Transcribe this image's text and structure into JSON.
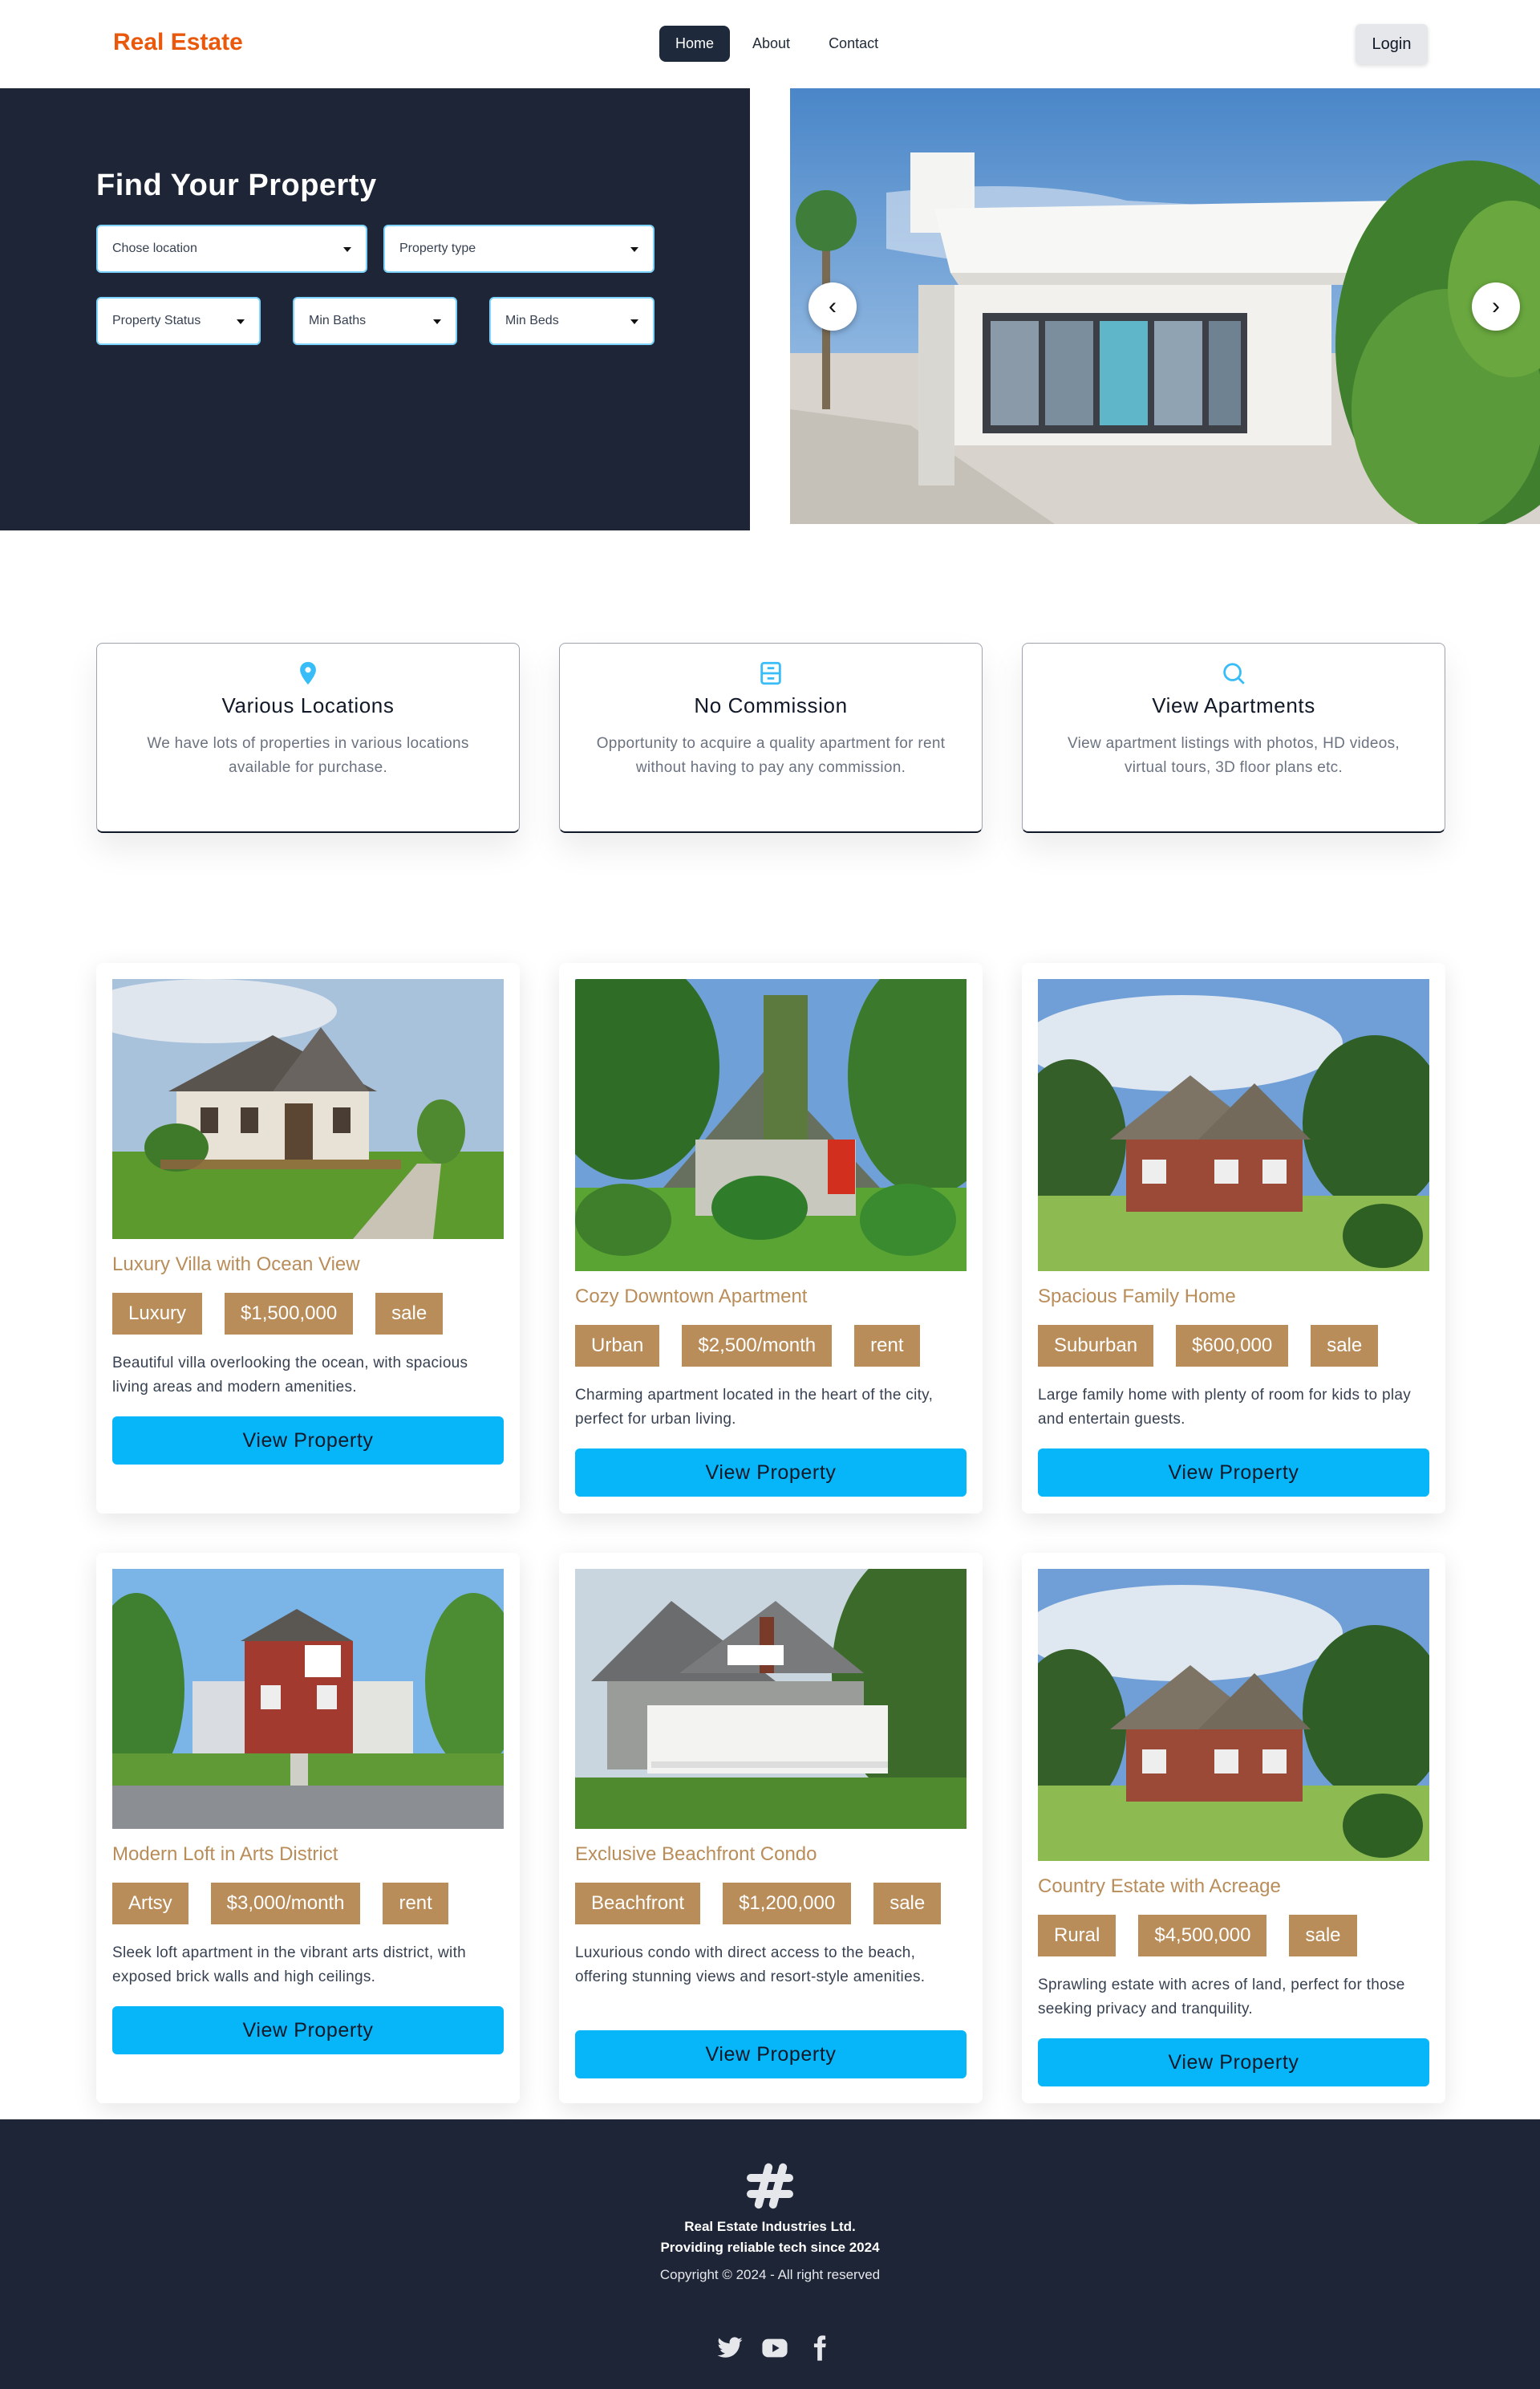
{
  "nav": {
    "brand": "Real Estate",
    "links": [
      "Home",
      "About",
      "Contact"
    ],
    "login": "Login"
  },
  "hero": {
    "title": "Find Your Property",
    "filters": {
      "location": "Chose location",
      "type": "Property type",
      "status": "Property Status",
      "baths": "Min Baths",
      "beds": "Min Beds"
    },
    "prev": "‹",
    "next": "›"
  },
  "features": [
    {
      "icon": "location-pin-icon",
      "title": "Various Locations",
      "text": "We have lots of properties in various locations available for purchase."
    },
    {
      "icon": "file-cabinet-icon",
      "title": "No Commission",
      "text": "Opportunity to acquire a quality apartment for rent without having to pay any commission."
    },
    {
      "icon": "search-icon",
      "title": "View Apartments",
      "text": "View apartment listings with photos, HD videos, virtual tours, 3D floor plans etc."
    }
  ],
  "listings": [
    {
      "title": "Luxury Villa with Ocean View",
      "category": "Luxury",
      "price": "$1,500,000",
      "status": "sale",
      "desc": "Beautiful villa overlooking the ocean, with spacious living areas and modern amenities.",
      "button": "View Property"
    },
    {
      "title": "Cozy Downtown Apartment",
      "category": "Urban",
      "price": "$2,500/month",
      "status": "rent",
      "desc": "Charming apartment located in the heart of the city, perfect for urban living.",
      "button": "View Property"
    },
    {
      "title": "Spacious Family Home",
      "category": "Suburban",
      "price": "$600,000",
      "status": "sale",
      "desc": "Large family home with plenty of room for kids to play and entertain guests.",
      "button": "View Property"
    },
    {
      "title": "Modern Loft in Arts District",
      "category": "Artsy",
      "price": "$3,000/month",
      "status": "rent",
      "desc": "Sleek loft apartment in the vibrant arts district, with exposed brick walls and high ceilings.",
      "button": "View Property"
    },
    {
      "title": "Exclusive Beachfront Condo",
      "category": "Beachfront",
      "price": "$1,200,000",
      "status": "sale",
      "desc": "Luxurious condo with direct access to the beach, offering stunning views and resort-style amenities.",
      "button": "View Property"
    },
    {
      "title": "Country Estate with Acreage",
      "category": "Rural",
      "price": "$4,500,000",
      "status": "sale",
      "desc": "Sprawling estate with acres of land, perfect for those seeking privacy and tranquility.",
      "button": "View Property"
    }
  ],
  "footer": {
    "company": "Real Estate Industries Ltd.",
    "tagline": "Providing reliable tech since 2024",
    "copyright": "Copyright © 2024 - All right reserved",
    "socials": [
      "twitter-icon",
      "youtube-icon",
      "facebook-icon"
    ]
  },
  "colors": {
    "brand": "#ea580c",
    "navy": "#1e2537",
    "tag": "#b98d5a",
    "button": "#06b6f9",
    "accent_border": "#7dd3fc"
  }
}
